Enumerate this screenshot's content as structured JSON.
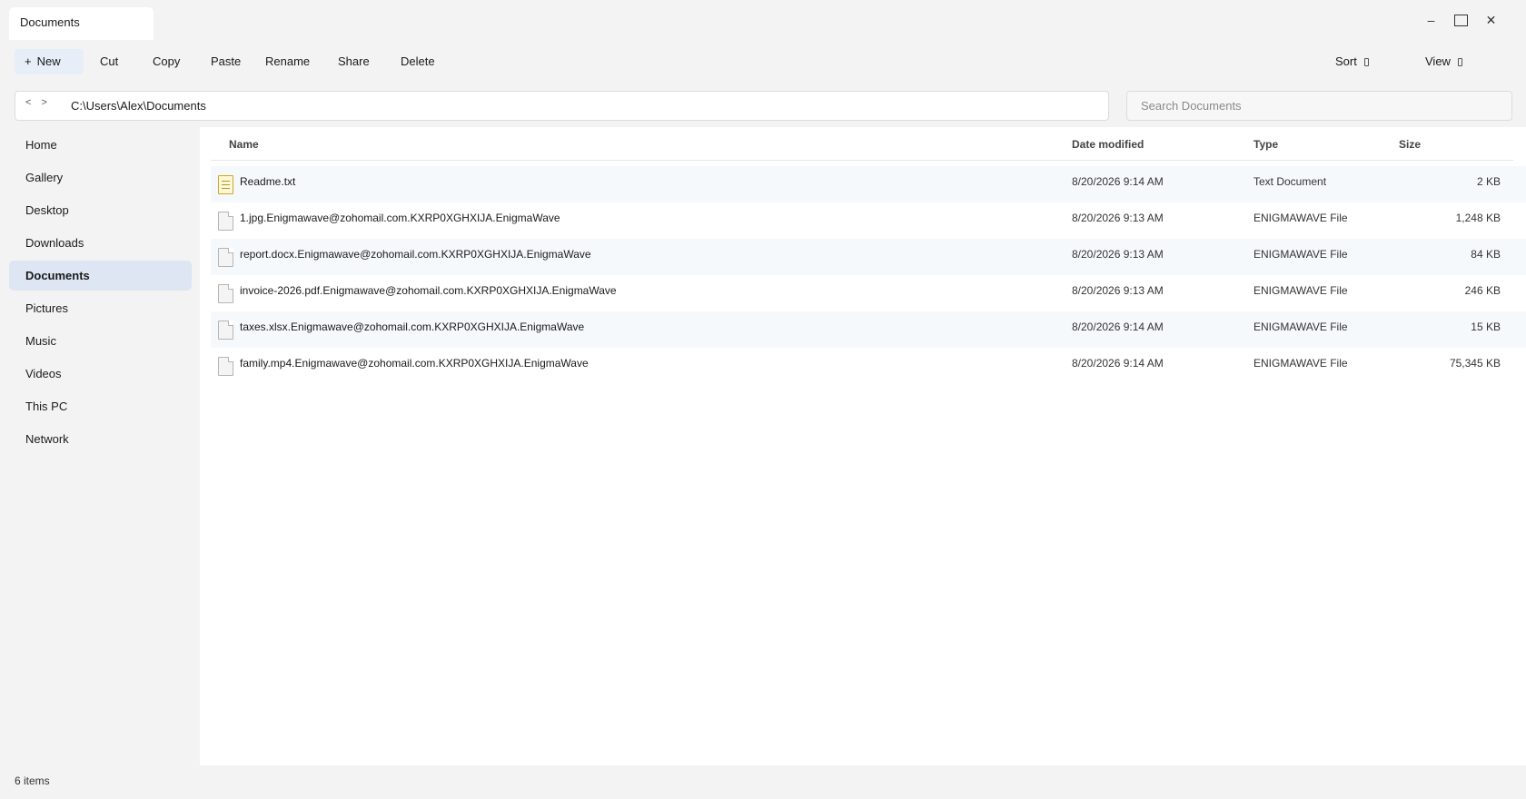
{
  "window": {
    "tab_title": "Documents",
    "minimize_glyph": "–",
    "close_glyph": "✕"
  },
  "toolbar": {
    "new_label": "New",
    "new_icon": "+",
    "cut_label": "Cut",
    "copy_label": "Copy",
    "paste_label": "Paste",
    "rename_label": "Rename",
    "share_label": "Share",
    "delete_label": "Delete",
    "sort_label": "Sort",
    "view_label": "View"
  },
  "address": {
    "nav_glyphs": "< >",
    "path": "C:\\Users\\Alex\\Documents"
  },
  "search": {
    "placeholder": "Search Documents"
  },
  "sidebar": {
    "items": [
      {
        "label": "Home"
      },
      {
        "label": "Gallery"
      },
      {
        "label": "Desktop"
      },
      {
        "label": "Downloads"
      },
      {
        "label": "Documents",
        "active": true
      },
      {
        "label": "Pictures"
      },
      {
        "label": "Music"
      },
      {
        "label": "Videos"
      },
      {
        "label": "This PC"
      },
      {
        "label": "Network"
      }
    ]
  },
  "table": {
    "headers": {
      "name": "Name",
      "date": "Date modified",
      "type": "Type",
      "size": "Size"
    },
    "rows": [
      {
        "name": "Readme.txt",
        "date": "8/20/2026 9:14 AM",
        "type": "Text Document",
        "size": "2 KB",
        "icon": "text-file-icon"
      },
      {
        "name": "1.jpg.Enigmawave@zohomail.com.KXRP0XGHXIJA.EnigmaWave",
        "date": "8/20/2026 9:13 AM",
        "type": "ENIGMAWAVE File",
        "size": "1,248 KB",
        "icon": "generic-file-icon"
      },
      {
        "name": "report.docx.Enigmawave@zohomail.com.KXRP0XGHXIJA.EnigmaWave",
        "date": "8/20/2026 9:13 AM",
        "type": "ENIGMAWAVE File",
        "size": "84 KB",
        "icon": "generic-file-icon"
      },
      {
        "name": "invoice-2026.pdf.Enigmawave@zohomail.com.KXRP0XGHXIJA.EnigmaWave",
        "date": "8/20/2026 9:13 AM",
        "type": "ENIGMAWAVE File",
        "size": "246 KB",
        "icon": "generic-file-icon"
      },
      {
        "name": "taxes.xlsx.Enigmawave@zohomail.com.KXRP0XGHXIJA.EnigmaWave",
        "date": "8/20/2026 9:14 AM",
        "type": "ENIGMAWAVE File",
        "size": "15 KB",
        "icon": "generic-file-icon"
      },
      {
        "name": "family.mp4.Enigmawave@zohomail.com.KXRP0XGHXIJA.EnigmaWave",
        "date": "8/20/2026 9:14 AM",
        "type": "ENIGMAWAVE File",
        "size": "75,345 KB",
        "icon": "generic-file-icon"
      }
    ]
  },
  "status": {
    "item_count": "6 items"
  }
}
